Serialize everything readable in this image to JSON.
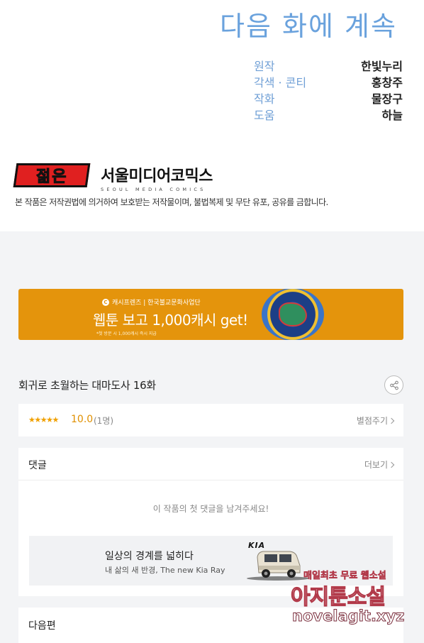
{
  "webtoon_end": {
    "to_be_continued": "다음 화에 계속",
    "credits": [
      {
        "role": "원작",
        "name": "한빛누리"
      },
      {
        "role": "각색 · 콘티",
        "name": "홍창주"
      },
      {
        "role": "작화",
        "name": "물장구"
      },
      {
        "role": "도움",
        "name": "하늘"
      }
    ],
    "publisher_logo": "젊은",
    "publisher_name": "서울미디어코믹스",
    "publisher_name_en": "SEOUL MEDIA COMICS",
    "copyright_notice": "본 작품은 저작권법에 의거하여 보호받는 저작물이며, 불법복제 및 무단 유포, 공유를 금합니다."
  },
  "banner": {
    "sponsor": "캐시프렌즈 | 한국불교문화사업단",
    "title": "웹툰 보고 1,000캐시 get!",
    "note": "*첫 방문 시 1,000캐시 즉시 지급",
    "accent": "#e4940c"
  },
  "episode": {
    "title": "회귀로 초월하는 대마도사 16화"
  },
  "rating": {
    "stars": "★★★★★",
    "score": "10.0",
    "count": "(1명)",
    "rate_label": "별점주기"
  },
  "comments": {
    "label": "댓글",
    "more_label": "더보기",
    "empty_message": "이 작품의 첫 댓글을 남겨주세요!"
  },
  "ad": {
    "brand": "KIA",
    "title": "일상의 경계를 넓히다",
    "subtitle": "내 삶의 새 반경, The new Kia Ray"
  },
  "next": {
    "label": "다음편"
  },
  "watermark": {
    "line1": "매일최초 무료 웹소설",
    "line2": "아지툰소설",
    "url": "novelagit.xyz"
  }
}
